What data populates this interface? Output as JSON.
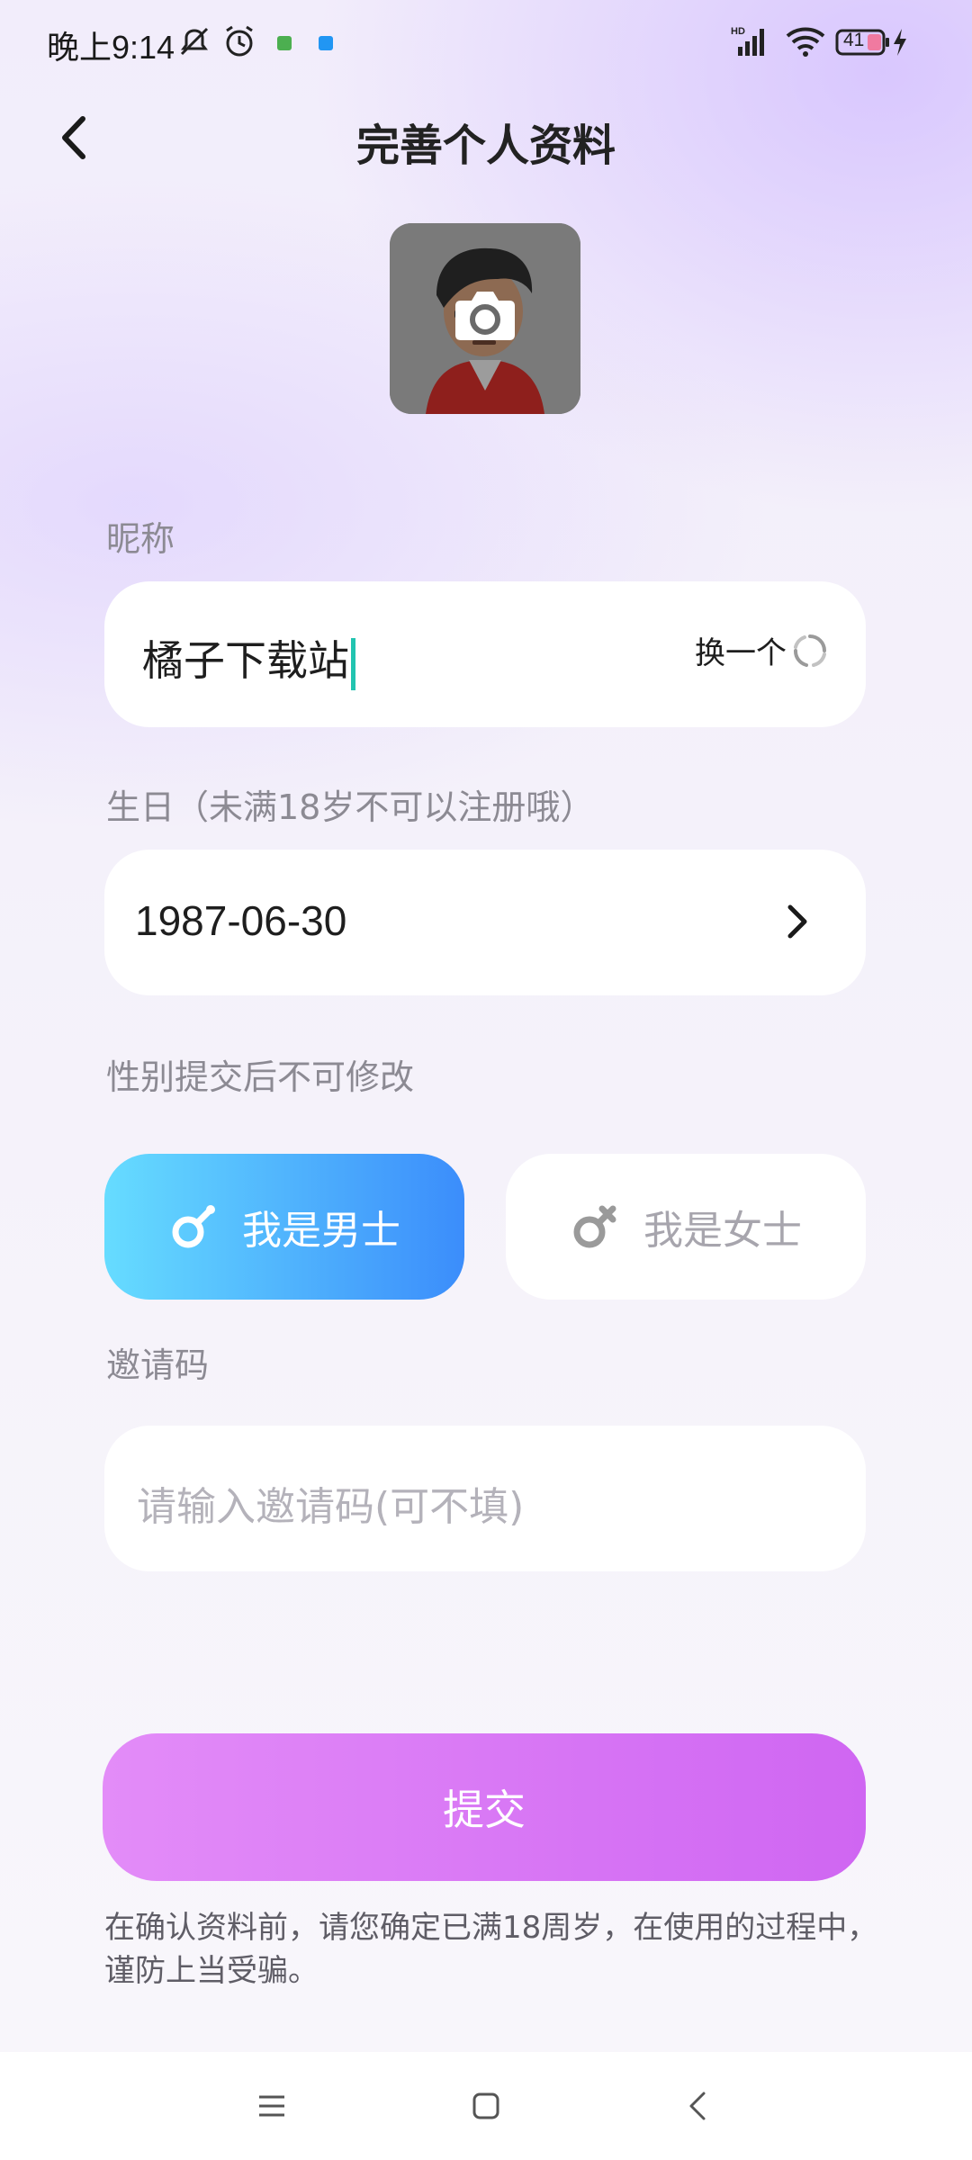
{
  "status_bar": {
    "time": "晚上9:14",
    "battery": "41"
  },
  "header": {
    "title": "完善个人资料"
  },
  "form": {
    "nickname_label": "昵称",
    "nickname_value": "橘子下载站",
    "change_label": "换一个",
    "birthday_label": "生日（未满18岁不可以注册哦）",
    "birthday_value": "1987-06-30",
    "gender_label": "性别提交后不可修改",
    "male_label": "我是男士",
    "female_label": "我是女士",
    "invite_label": "邀请码",
    "invite_placeholder": "请输入邀请码(可不填)"
  },
  "submit_label": "提交",
  "notice": "在确认资料前，请您确定已满18周岁，在使用的过程中，谨防上当受骗。",
  "colors": {
    "male_gradient": [
      "#66dcff",
      "#3b8dfb"
    ],
    "submit_gradient": [
      "#e38cf8",
      "#cf66f2"
    ],
    "caret": "#22c4b0"
  },
  "icons": [
    "back-arrow-icon",
    "camera-icon",
    "refresh-icon",
    "chevron-right-icon",
    "male-symbol-icon",
    "female-symbol-icon"
  ]
}
